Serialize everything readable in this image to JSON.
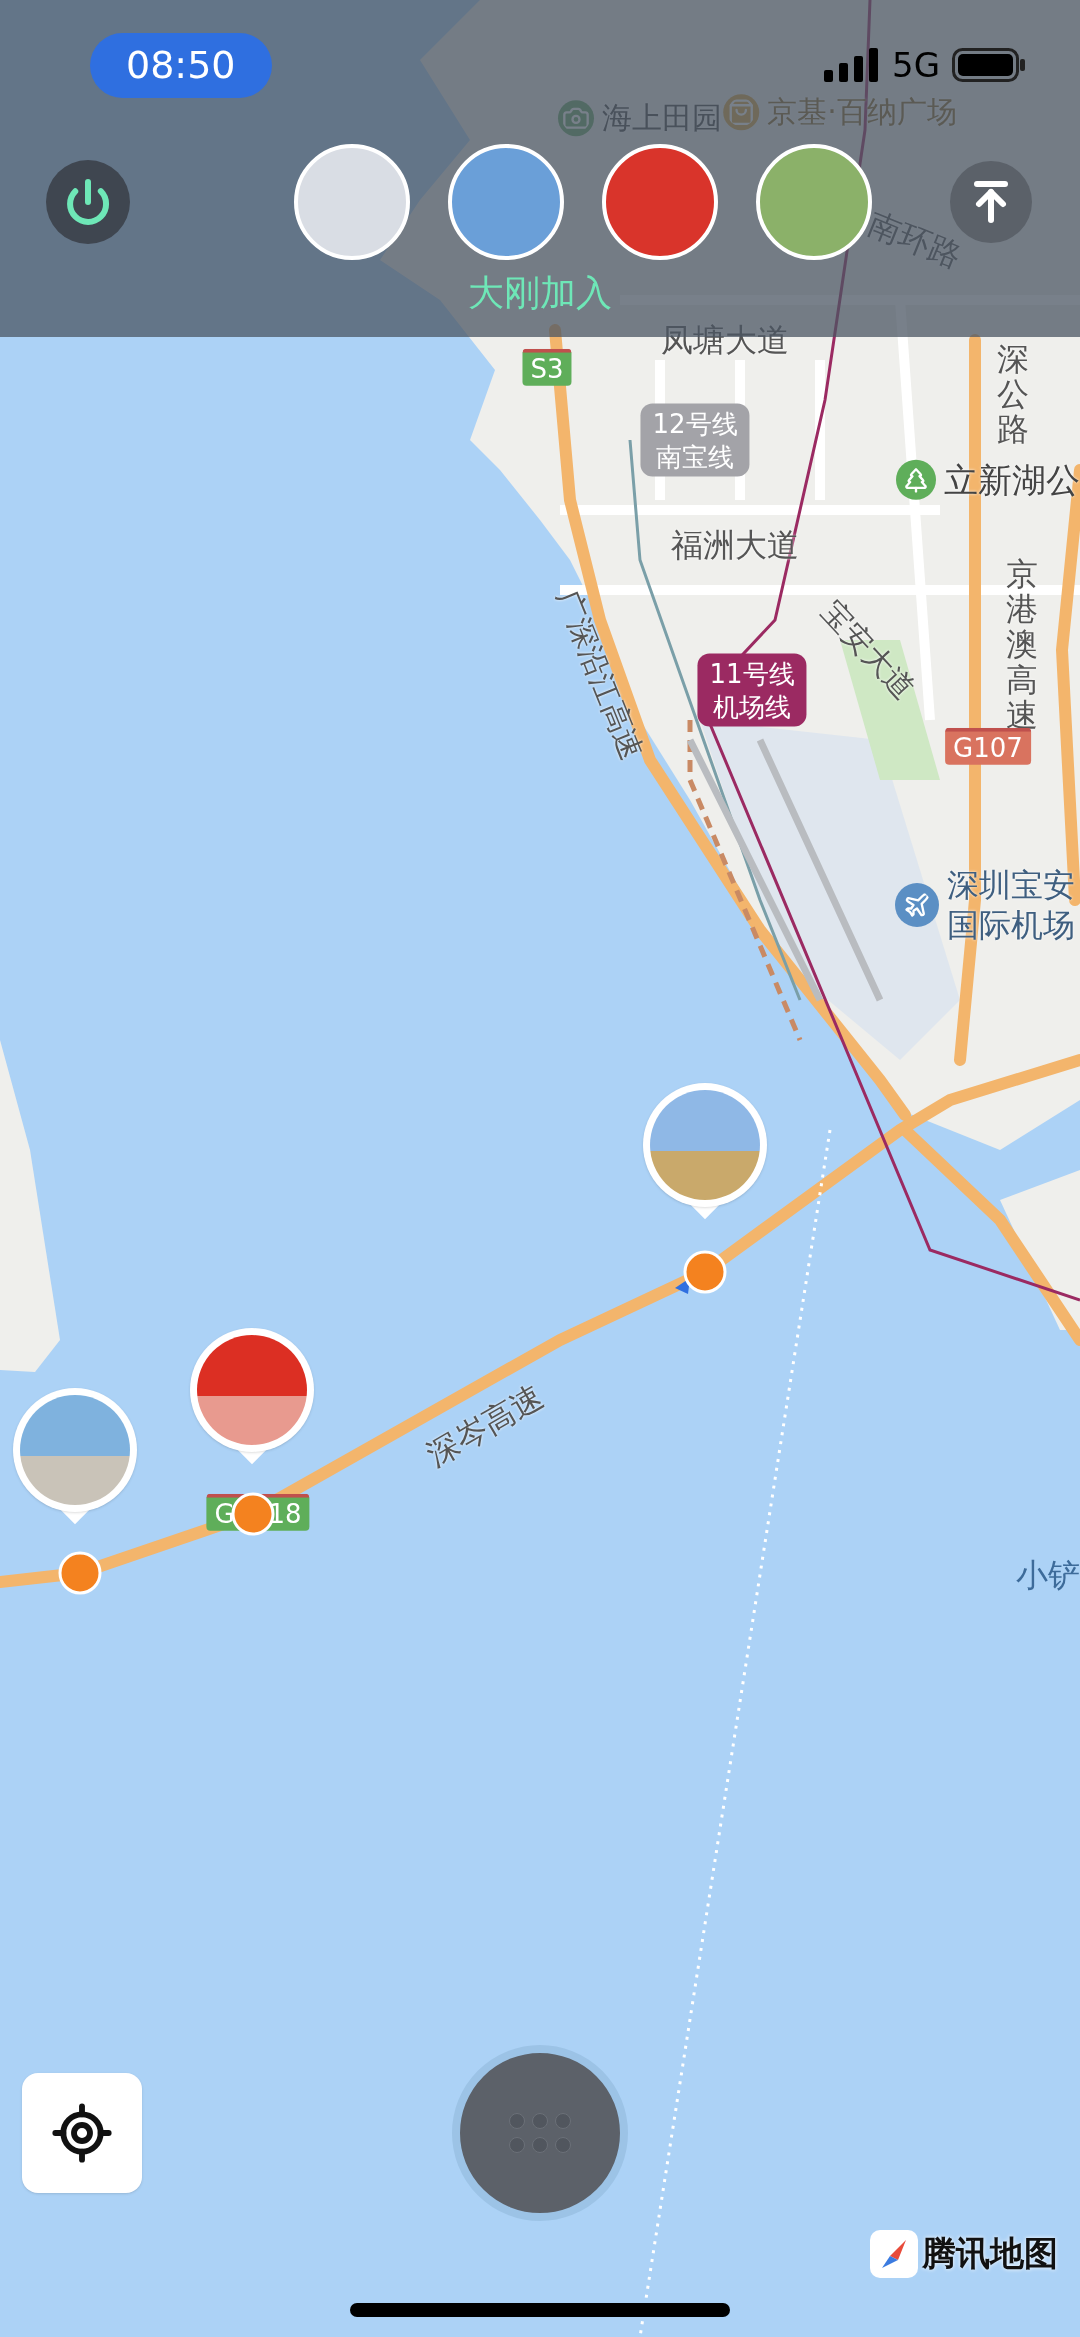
{
  "status_bar": {
    "time": "08:50",
    "network": "5G"
  },
  "members_bar": {
    "joined_notice": "大刚加入"
  },
  "map": {
    "labels": [
      {
        "kind": "scenic",
        "lines": [
          "海上田园"
        ]
      },
      {
        "kind": "mall",
        "lines": [
          "京基·百纳广场"
        ]
      },
      {
        "kind": "road",
        "lines": [
          "南环路"
        ]
      },
      {
        "kind": "road",
        "lines": [
          "凤塘大道"
        ]
      },
      {
        "kind": "shield",
        "lines": [
          "S3"
        ],
        "color": "#5fae5a"
      },
      {
        "kind": "metro",
        "lines": [
          "12号线",
          "南宝线"
        ],
        "color": "#a3a3a8"
      },
      {
        "kind": "vroad",
        "lines": [
          "深公路"
        ]
      },
      {
        "kind": "park",
        "lines": [
          "立新湖公"
        ]
      },
      {
        "kind": "road",
        "lines": [
          "福洲大道"
        ]
      },
      {
        "kind": "road",
        "lines": [
          "广深沿江高速"
        ]
      },
      {
        "kind": "metro",
        "lines": [
          "11号线",
          "机场线"
        ],
        "color": "#9b2a62"
      },
      {
        "kind": "road",
        "lines": [
          "宝安大道"
        ]
      },
      {
        "kind": "vroad",
        "lines": [
          "京港澳高速"
        ]
      },
      {
        "kind": "shield",
        "lines": [
          "G107"
        ],
        "color": "#d9735f"
      },
      {
        "kind": "airport",
        "lines": [
          "深圳宝安",
          "国际机场"
        ]
      },
      {
        "kind": "road",
        "lines": [
          "深岑高速"
        ]
      },
      {
        "kind": "shield",
        "lines": [
          "G",
          "18"
        ],
        "color": "#5fae5a"
      },
      {
        "kind": "water",
        "lines": [
          "小铲"
        ]
      }
    ],
    "attribution": "腾讯地图"
  }
}
